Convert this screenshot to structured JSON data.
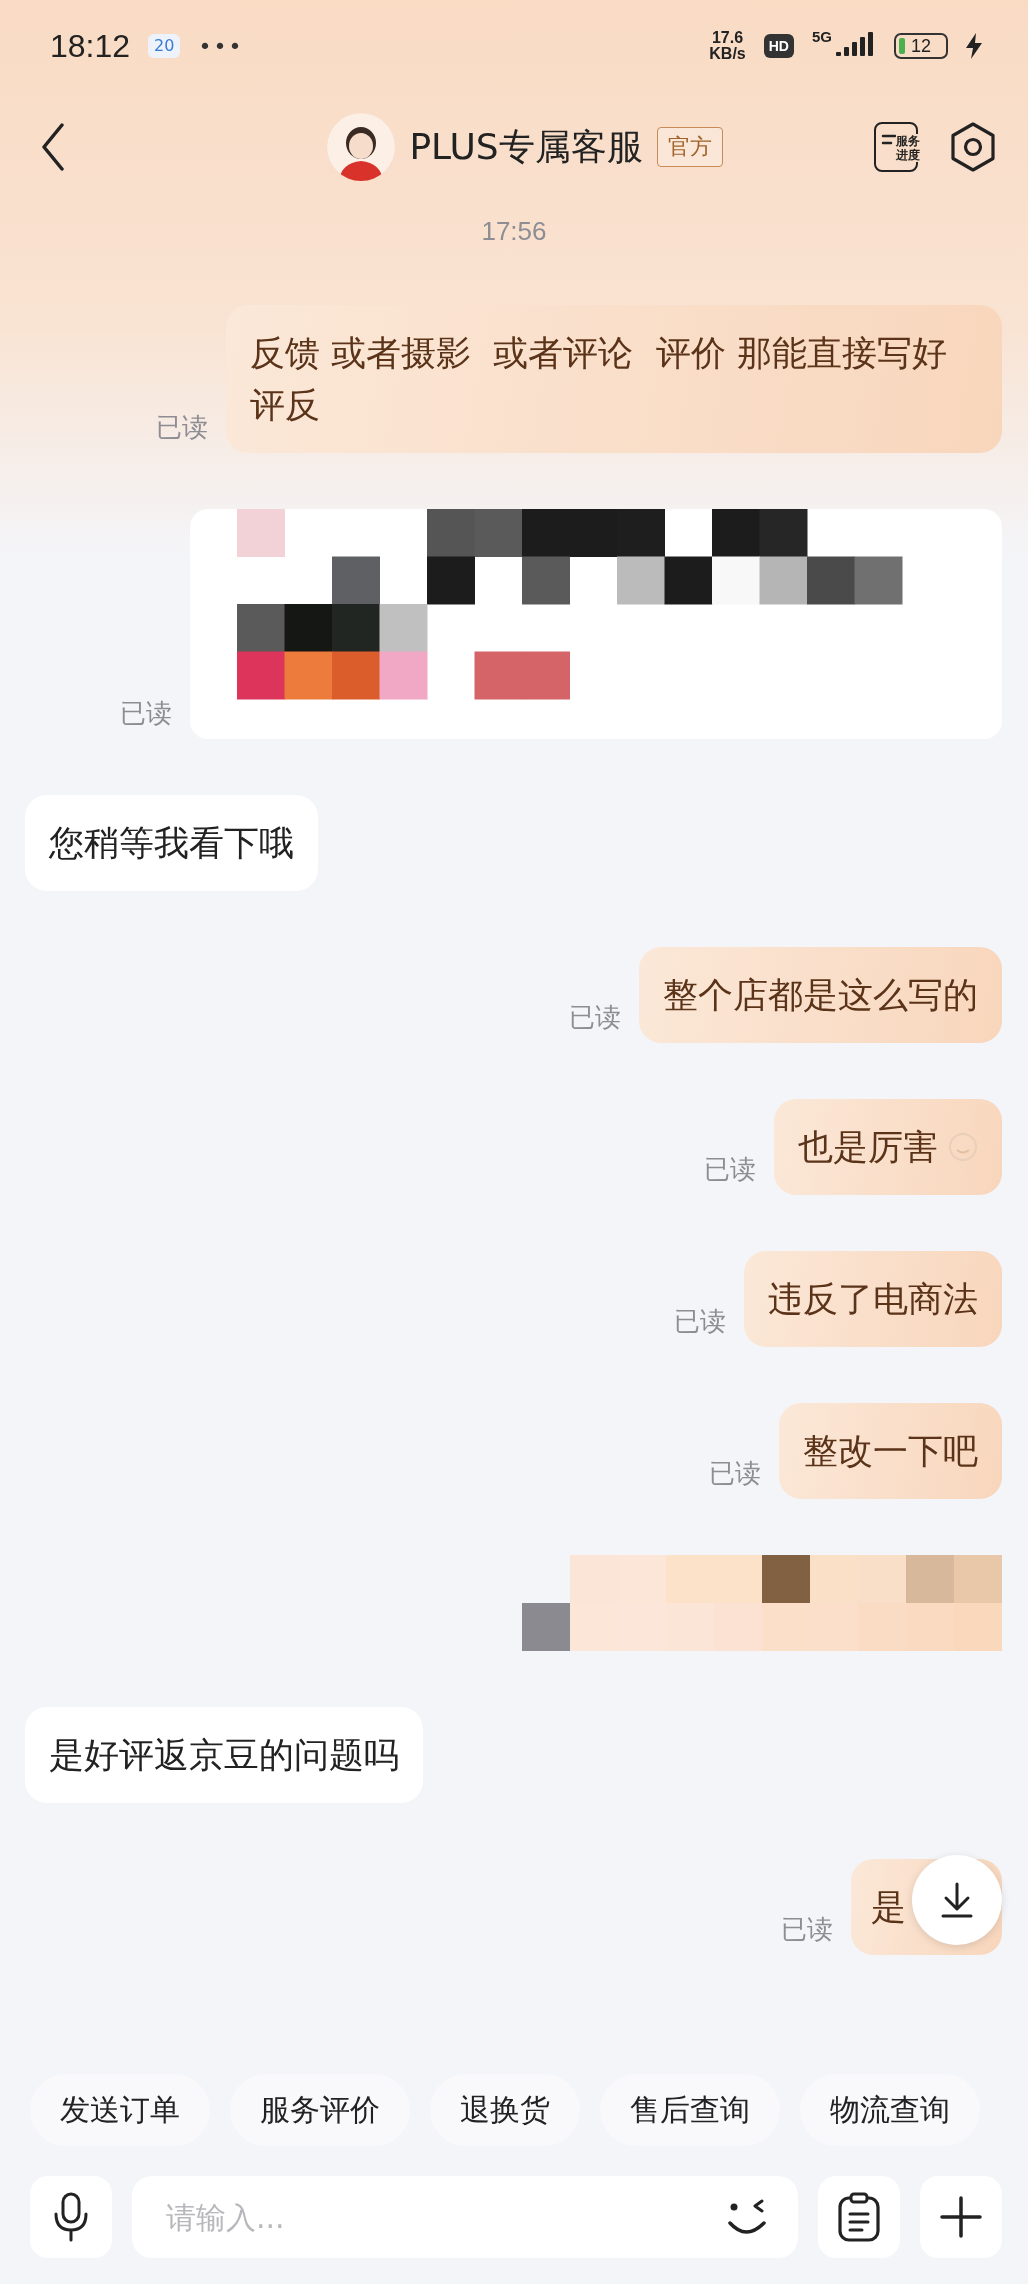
{
  "status_bar": {
    "time": "18:12",
    "date_badge": "20",
    "more": "•••",
    "speed": "17.6",
    "speed_unit": "KB/s",
    "hd": "HD",
    "network": "5G",
    "battery": "12"
  },
  "header": {
    "title": "PLUS专属客服",
    "badge": "官方",
    "progress_lines": [
      "服务",
      "进度"
    ]
  },
  "timestamp": "17:56",
  "messages": [
    {
      "mine": true,
      "kind": "text",
      "text": "反馈 或者摄影  或者评论  评价 那能直接写好评反",
      "read": "已读"
    },
    {
      "mine": true,
      "kind": "picture",
      "read": "已读"
    },
    {
      "mine": false,
      "kind": "text",
      "text": "您稍等我看下哦"
    },
    {
      "mine": true,
      "kind": "text",
      "text": "整个店都是这么写的",
      "read": "已读"
    },
    {
      "mine": true,
      "kind": "text",
      "text": "也是厉害",
      "read": "已读",
      "emoji": true
    },
    {
      "mine": true,
      "kind": "text",
      "text": "违反了电商法",
      "read": "已读"
    },
    {
      "mine": true,
      "kind": "text",
      "text": "整改一下吧",
      "read": "已读"
    },
    {
      "mine": true,
      "kind": "picture"
    },
    {
      "mine": false,
      "kind": "text",
      "text": "是好评返京豆的问题吗"
    },
    {
      "mine": true,
      "kind": "text",
      "text": "是",
      "read": "已读",
      "covered": true
    }
  ],
  "quick_replies": [
    "发送订单",
    "服务评价",
    "退换货",
    "售后查询",
    "物流查询"
  ],
  "input": {
    "placeholder": "请输入..."
  }
}
